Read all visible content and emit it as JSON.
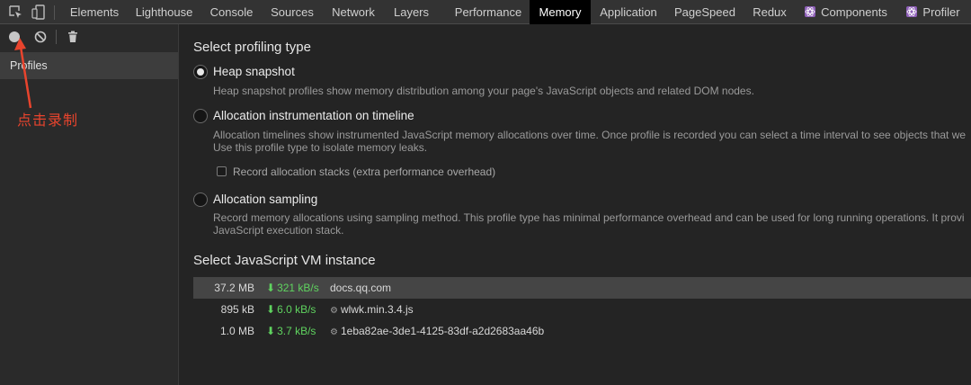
{
  "tabs": [
    {
      "label": "Elements",
      "active": false
    },
    {
      "label": "Lighthouse",
      "active": false
    },
    {
      "label": "Console",
      "active": false
    },
    {
      "label": "Sources",
      "active": false
    },
    {
      "label": "Network",
      "active": false
    },
    {
      "label": "Layers",
      "active": false
    },
    {
      "label": "Performance",
      "active": false
    },
    {
      "label": "Memory",
      "active": true
    },
    {
      "label": "Application",
      "active": false
    },
    {
      "label": "PageSpeed",
      "active": false
    },
    {
      "label": "Redux",
      "active": false
    },
    {
      "label": "Components",
      "active": false,
      "icon": "react-icon"
    },
    {
      "label": "Profiler",
      "active": false,
      "icon": "react-icon"
    }
  ],
  "toolbar_icons": [
    "inspect-element-icon",
    "device-toggle-icon"
  ],
  "sidebar": {
    "buttons": [
      "record-icon",
      "clear-icon",
      "trash-icon"
    ],
    "profiles_label": "Profiles",
    "annotation": "点击录制"
  },
  "main": {
    "profiling_heading": "Select profiling type",
    "options": [
      {
        "label": "Heap snapshot",
        "checked": true,
        "desc": [
          "Heap snapshot profiles show memory distribution among your page's JavaScript objects and related DOM nodes."
        ]
      },
      {
        "label": "Allocation instrumentation on timeline",
        "checked": false,
        "desc": [
          "Allocation timelines show instrumented JavaScript memory allocations over time. Once profile is recorded you can select a time interval to see objects that we",
          "Use this profile type to isolate memory leaks."
        ]
      },
      {
        "label": "Allocation sampling",
        "checked": false,
        "desc": [
          "Record memory allocations using sampling method. This profile type has minimal performance overhead and can be used for long running operations. It provi",
          "JavaScript execution stack."
        ]
      }
    ],
    "record_stacks_label": "Record allocation stacks (extra performance overhead)",
    "vm_heading": "Select JavaScript VM instance",
    "vm_instances": [
      {
        "size": "37.2 MB",
        "rate": "321 kB/s",
        "name": "docs.qq.com",
        "gear": false,
        "selected": true
      },
      {
        "size": "895 kB",
        "rate": "6.0 kB/s",
        "name": "wlwk.min.3.4.js",
        "gear": true,
        "selected": false
      },
      {
        "size": "1.0 MB",
        "rate": "3.7 kB/s",
        "name": "1eba82ae-3de1-4125-83df-a2d2683aa46b",
        "gear": true,
        "selected": false
      }
    ]
  },
  "colors": {
    "accent_green": "#5fd35f",
    "annotation_red": "#e8442d",
    "react_purple": "#b27bd6"
  }
}
